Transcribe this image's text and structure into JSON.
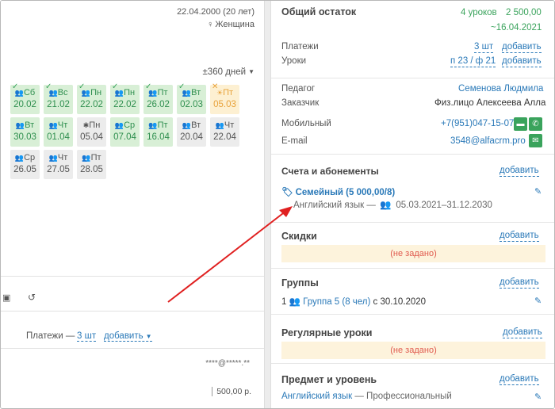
{
  "profile": {
    "dob": "22.04.2000 (20 лет)",
    "gender": "Женщина",
    "gender_icon": "female-icon"
  },
  "calendar": {
    "range_label": "±360 дней",
    "rows": [
      [
        {
          "day": "Сб",
          "date": "20.02",
          "status": "green",
          "mark": "check"
        },
        {
          "day": "Вс",
          "date": "21.02",
          "status": "green",
          "mark": "check"
        },
        {
          "day": "Пн",
          "date": "22.02",
          "status": "green",
          "mark": "check"
        },
        {
          "day": "Пн",
          "date": "22.02",
          "status": "green",
          "mark": "check"
        },
        {
          "day": "Пт",
          "date": "26.02",
          "status": "green",
          "mark": "check"
        },
        {
          "day": "Вт",
          "date": "02.03",
          "status": "green",
          "mark": "check"
        },
        {
          "day": "Пт",
          "date": "05.03",
          "status": "orange",
          "mark": "x"
        }
      ],
      [
        {
          "day": "Вт",
          "date": "30.03",
          "status": "green",
          "mark": ""
        },
        {
          "day": "Чт",
          "date": "01.04",
          "status": "green",
          "mark": ""
        },
        {
          "day": "Пн",
          "date": "05.04",
          "status": "gray",
          "mark": ""
        },
        {
          "day": "Ср",
          "date": "07.04",
          "status": "green",
          "mark": ""
        },
        {
          "day": "Пт",
          "date": "16.04",
          "status": "green",
          "mark": ""
        },
        {
          "day": "Вт",
          "date": "20.04",
          "status": "gray",
          "mark": ""
        },
        {
          "day": "Чт",
          "date": "22.04",
          "status": "gray",
          "mark": ""
        }
      ],
      [
        {
          "day": "Ср",
          "date": "26.05",
          "status": "gray",
          "mark": ""
        },
        {
          "day": "Чт",
          "date": "27.05",
          "status": "gray",
          "mark": ""
        },
        {
          "day": "Пт",
          "date": "28.05",
          "status": "gray",
          "mark": ""
        }
      ]
    ]
  },
  "left_payments": {
    "label": "Платежи —",
    "count": "3 шт",
    "add": "добавить"
  },
  "left_masked": "****@*****.**",
  "left_amount": "500,00 р.",
  "balance": {
    "title": "Общий остаток",
    "lessons": "4 уроков",
    "amount": "2 500,00",
    "date": "~16.04.2021"
  },
  "payments": {
    "label": "Платежи",
    "count": "3 шт",
    "add": "добавить"
  },
  "lessons": {
    "label": "Уроки",
    "value": "п 23 / ф 21",
    "add": "добавить"
  },
  "teacher": {
    "label": "Педагог",
    "value": "Семенова Людмила"
  },
  "customer": {
    "label": "Заказчик",
    "value": "Физ.лицо Алексеева Алла"
  },
  "mobile": {
    "label": "Мобильный",
    "value": "+7(951)047-15-07"
  },
  "email": {
    "label": "E-mail",
    "value": "3548@alfacrm.pro"
  },
  "accounts": {
    "title": "Счета и абонементы",
    "add": "добавить",
    "item_name": "Семейный (5 000,00/8)",
    "item_subject": "Английский язык —",
    "item_period": "05.03.2021–31.12.2030"
  },
  "discounts": {
    "title": "Скидки",
    "add": "добавить",
    "empty": "(не задано)"
  },
  "groups": {
    "title": "Группы",
    "add": "добавить",
    "count": "1",
    "group": "Группа 5 (8 чел)",
    "since": "с 30.10.2020"
  },
  "regular": {
    "title": "Регулярные уроки",
    "add": "добавить",
    "empty": "(не задано)"
  },
  "subject": {
    "title": "Предмет и уровень",
    "add": "добавить",
    "name": "Английский язык",
    "level": "— Профессиональный"
  },
  "colors": {
    "accent": "#2a79b8",
    "green": "#3aa35c",
    "warning_bg": "#fdf3dc",
    "warning_text": "#e05a4e",
    "arrow": "#e02020"
  }
}
